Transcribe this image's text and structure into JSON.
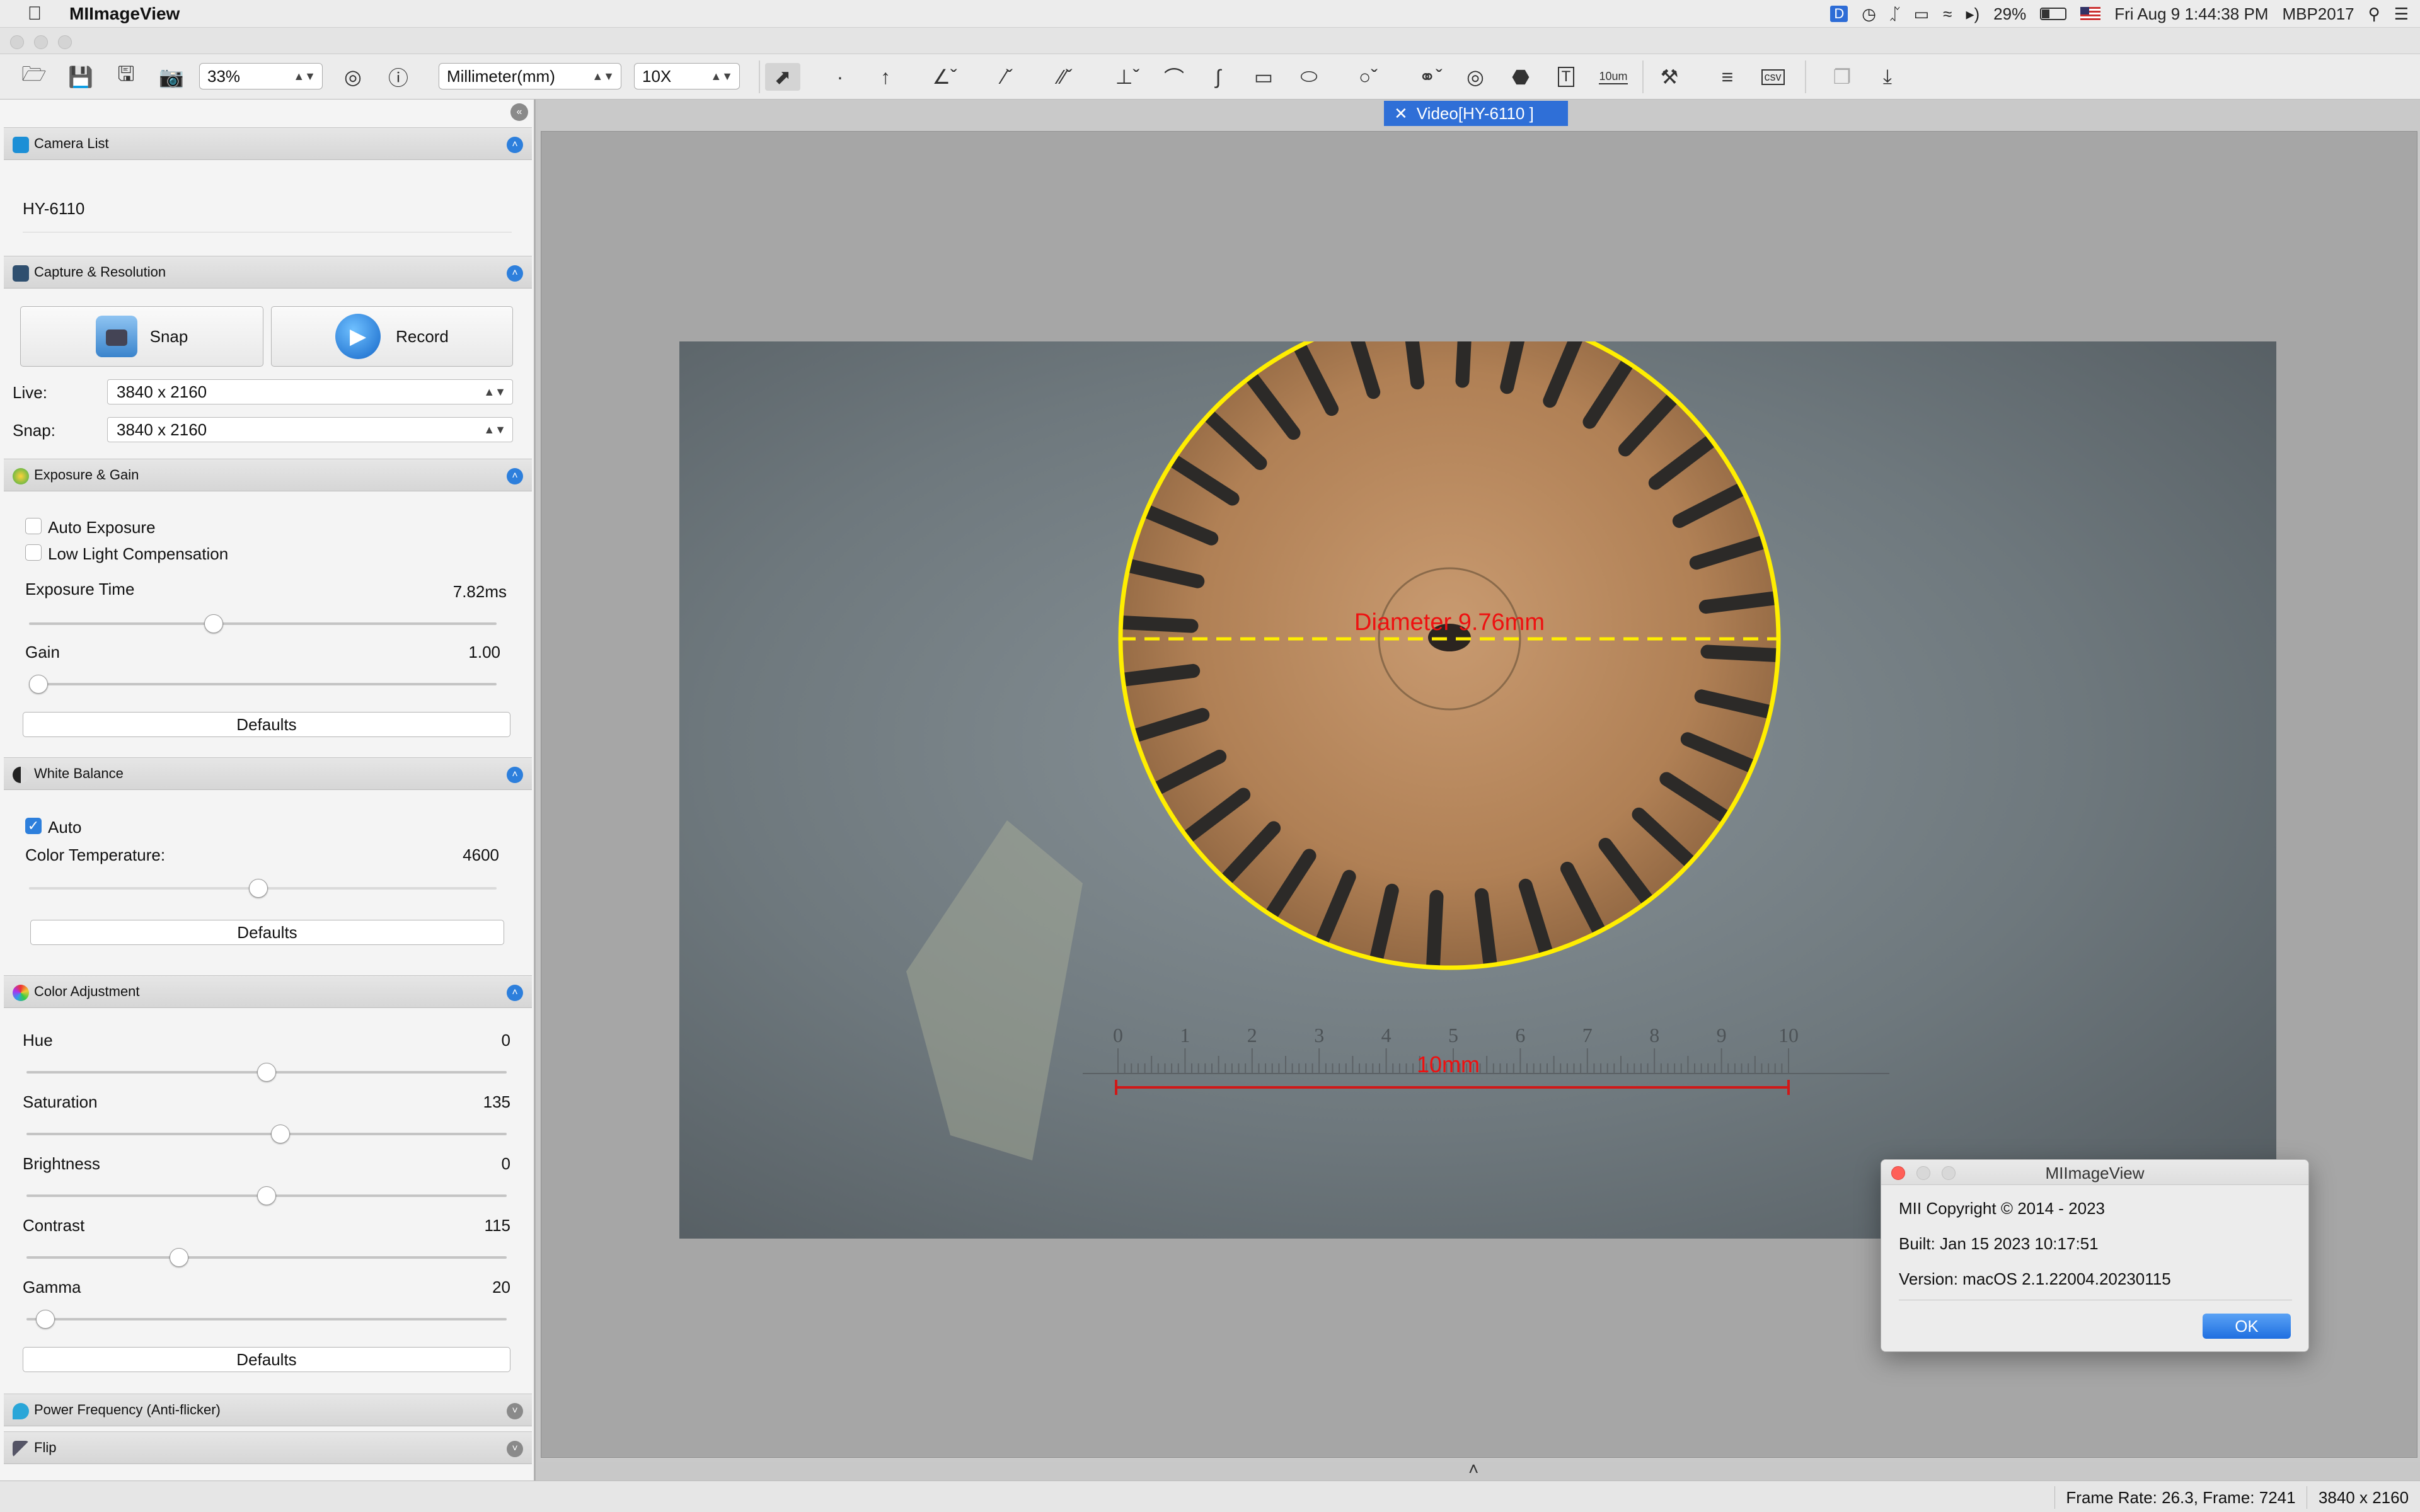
{
  "menubar": {
    "app_name": "MIImageView",
    "battery": "29%",
    "datetime": "Fri Aug 9  1:44:38 PM",
    "host": "MBP2017"
  },
  "toolbar": {
    "zoom": "33%",
    "unit": "Millimeter(mm)",
    "magnification": "10X",
    "scale_tool_label": "10um"
  },
  "sidebar": {
    "camera_list": {
      "title": "Camera List",
      "camera": "HY-6110"
    },
    "capture": {
      "title": "Capture & Resolution",
      "snap_label": "Snap",
      "record_label": "Record",
      "live_label": "Live:",
      "live_value": "3840 x 2160",
      "snap_res_label": "Snap:",
      "snap_res_value": "3840 x 2160"
    },
    "exposure": {
      "title": "Exposure & Gain",
      "auto_exposure": "Auto Exposure",
      "low_light": "Low Light Compensation",
      "exposure_time_label": "Exposure Time",
      "exposure_time_value": "7.82ms",
      "exposure_level": 0.39,
      "gain_label": "Gain",
      "gain_value": "1.00",
      "gain_level": 0.0,
      "defaults": "Defaults"
    },
    "white_balance": {
      "title": "White Balance",
      "auto": "Auto",
      "color_temp_label": "Color Temperature:",
      "color_temp_value": "4600",
      "color_temp_level": 0.49,
      "defaults": "Defaults"
    },
    "color_adjust": {
      "title": "Color Adjustment",
      "hue_label": "Hue",
      "hue_value": "0",
      "hue_level": 0.5,
      "saturation_label": "Saturation",
      "saturation_value": "135",
      "saturation_level": 0.53,
      "brightness_label": "Brightness",
      "brightness_value": "0",
      "brightness_level": 0.5,
      "contrast_label": "Contrast",
      "contrast_value": "115",
      "contrast_level": 0.31,
      "gamma_label": "Gamma",
      "gamma_value": "20",
      "gamma_level": 0.02,
      "defaults": "Defaults"
    },
    "power_freq": {
      "title": "Power Frequency (Anti-flicker)"
    },
    "flip": {
      "title": "Flip"
    }
  },
  "viewer": {
    "tab_label": "Video[HY-6110 ]",
    "diameter_label": "Diameter 9.76mm",
    "scale_label": "10mm",
    "ruler_ticks": [
      "0",
      "1",
      "2",
      "3",
      "4",
      "5",
      "6",
      "7",
      "8",
      "9",
      "10"
    ]
  },
  "about": {
    "title": "MIImageView",
    "copyright": "MII Copyright © 2014 - 2023",
    "built": "Built: Jan 15 2023 10:17:51",
    "version": "Version: macOS 2.1.22004.20230115",
    "ok": "OK"
  },
  "status": {
    "frame_info": "Frame Rate: 26.3, Frame: 7241",
    "resolution": "3840 x 2160"
  },
  "colors": {
    "accent": "#2d7fdc",
    "tab": "#2f6fd7",
    "circle": "#ffee00",
    "measure": "#e01010"
  }
}
